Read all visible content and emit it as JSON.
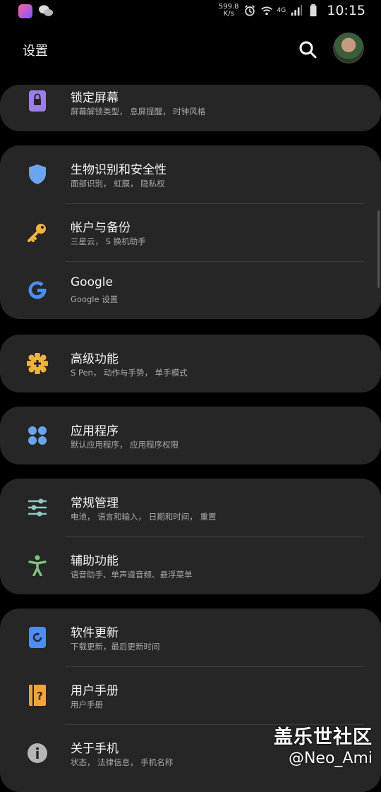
{
  "status": {
    "net_speed_value": "599.8",
    "net_speed_unit": "K/s",
    "network_label": "4G",
    "time": "10:15"
  },
  "header": {
    "title": "设置"
  },
  "items": [
    {
      "title": "锁定屏幕",
      "subtitle": "屏幕解锁类型， 息屏提醒， 时钟风格",
      "icon": "lock-icon",
      "color": "#9b7ee6"
    },
    {
      "title": "生物识别和安全性",
      "subtitle": "面部识别， 虹膜， 隐私权",
      "icon": "shield-icon",
      "color": "#6aa6f0"
    },
    {
      "title": "帐户与备份",
      "subtitle": "三星云， S 换机助手",
      "icon": "key-icon",
      "color": "#f2b23e"
    },
    {
      "title": "Google",
      "subtitle": "Google 设置",
      "icon": "google-icon",
      "color": "#4c8df6"
    },
    {
      "title": "高级功能",
      "subtitle": "S Pen， 动作与手势， 单手模式",
      "icon": "gear-plus-icon",
      "color": "#f2b23e"
    },
    {
      "title": "应用程序",
      "subtitle": "默认应用程序， 应用程序权限",
      "icon": "apps-grid-icon",
      "color": "#6aa6f0"
    },
    {
      "title": "常规管理",
      "subtitle": "电池， 语言和输入， 日期和时间， 重置",
      "icon": "sliders-icon",
      "color": "#8fc8c0"
    },
    {
      "title": "辅助功能",
      "subtitle": "语音助手、单声道音频、悬浮菜单",
      "icon": "accessibility-icon",
      "color": "#7cc27c"
    },
    {
      "title": "软件更新",
      "subtitle": "下载更新，最后更新时间",
      "icon": "update-icon",
      "color": "#4c8df6"
    },
    {
      "title": "用户手册",
      "subtitle": "用户手册",
      "icon": "manual-icon",
      "color": "#f2a23e"
    },
    {
      "title": "关于手机",
      "subtitle": "状态， 法律信息， 手机名称",
      "icon": "info-icon",
      "color": "#b5b5b5"
    }
  ],
  "watermark": {
    "title": "盖乐世社区",
    "handle": "@Neo_Ami"
  }
}
